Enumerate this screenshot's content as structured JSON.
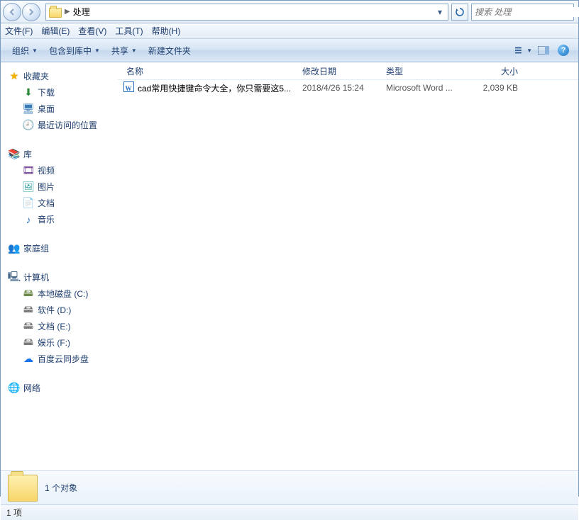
{
  "address": {
    "folder_name": "处理"
  },
  "search": {
    "placeholder": "搜索 处理"
  },
  "menu": {
    "file": "文件(F)",
    "edit": "编辑(E)",
    "view": "查看(V)",
    "tools": "工具(T)",
    "help": "帮助(H)"
  },
  "command": {
    "organize": "组织",
    "include": "包含到库中",
    "share": "共享",
    "newfolder": "新建文件夹"
  },
  "columns": {
    "name": "名称",
    "date": "修改日期",
    "type": "类型",
    "size": "大小"
  },
  "tree": {
    "favorites": "收藏夹",
    "downloads": "下载",
    "desktop": "桌面",
    "recent": "最近访问的位置",
    "libraries": "库",
    "videos": "视频",
    "pictures": "图片",
    "documents": "文档",
    "music": "音乐",
    "homegroup": "家庭组",
    "computer": "计算机",
    "drive_c": "本地磁盘 (C:)",
    "drive_d": "软件 (D:)",
    "drive_e": "文档 (E:)",
    "drive_f": "娱乐 (F:)",
    "baidu": "百度云同步盘",
    "network": "网络"
  },
  "files": [
    {
      "name": "cad常用快捷键命令大全，你只需要这5...",
      "date": "2018/4/26 15:24",
      "type": "Microsoft Word ...",
      "size": "2,039 KB"
    }
  ],
  "details": {
    "summary": "1 个对象"
  },
  "status": {
    "text": "1 项"
  }
}
